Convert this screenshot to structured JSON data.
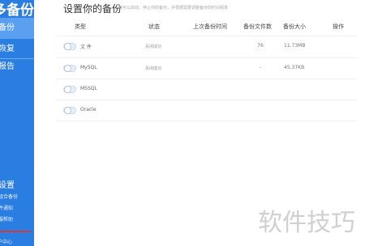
{
  "sidebar": {
    "title": "多备份",
    "items": [
      {
        "label": "备份",
        "active": true
      },
      {
        "label": "恢复",
        "active": false
      },
      {
        "label": "报告",
        "active": false
      }
    ],
    "settings_label": "设置",
    "sub_items": [
      "组合备份",
      "件通知",
      "服帮助"
    ],
    "footer": "户中心"
  },
  "header": {
    "title": "设置你的备份",
    "subtitle": "你可以启动，停止你的备份，并根据需要调整备份的时间频率"
  },
  "table": {
    "columns": [
      "类型",
      "状态",
      "上次备份时间",
      "备份文件数",
      "备份大小",
      "操作"
    ],
    "rows": [
      {
        "name": "文 件",
        "status": "关闭成功",
        "last_backup": "",
        "count": "76",
        "size": "11.73MB"
      },
      {
        "name": "MySQL",
        "status": "关闭成功",
        "last_backup": "",
        "count": "-",
        "size": "45.37KB"
      },
      {
        "name": "MSSQL",
        "status": "",
        "last_backup": "",
        "count": "",
        "size": ""
      },
      {
        "name": "Oracle",
        "status": "",
        "last_backup": "",
        "count": "",
        "size": ""
      }
    ]
  },
  "watermark": "软件技巧",
  "colors": {
    "sidebar_bg": "#2a7de1",
    "sidebar_active": "#5b9ff0",
    "accent_red": "#d8373a"
  }
}
